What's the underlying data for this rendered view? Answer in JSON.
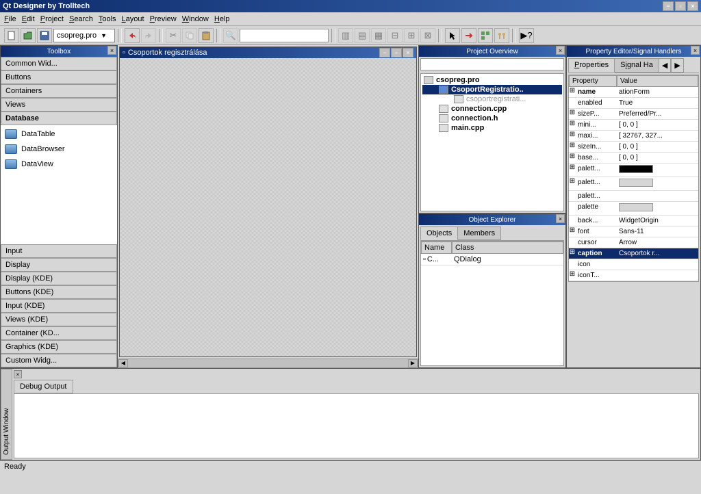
{
  "window": {
    "title": "Qt Designer by Trolltech"
  },
  "menus": {
    "file": "File",
    "edit": "Edit",
    "project": "Project",
    "search": "Search",
    "tools": "Tools",
    "layout": "Layout",
    "preview": "Preview",
    "window": "Window",
    "help": "Help"
  },
  "toolbar": {
    "project": "csopreg.pro"
  },
  "toolbox": {
    "title": "Toolbox",
    "sections": {
      "common": "Common Wid...",
      "buttons": "Buttons",
      "containers": "Containers",
      "views": "Views",
      "database": "Database",
      "input": "Input",
      "display": "Display",
      "displaykde": "Display (KDE)",
      "buttonskde": "Buttons (KDE)",
      "inputkde": "Input (KDE)",
      "viewskde": "Views (KDE)",
      "containerkde": "Container (KD...",
      "graphicskde": "Graphics (KDE)",
      "customwidg": "Custom Widg..."
    },
    "db_items": {
      "datatable": "DataTable",
      "databrowser": "DataBrowser",
      "dataview": "DataView"
    }
  },
  "design": {
    "title": "Csoportok regisztrálása"
  },
  "projectOverview": {
    "title": "Project Overview",
    "root": "csopreg.pro",
    "item_form": "CsoportRegistratio..",
    "item_ui": "csoportregistrati...",
    "item_conn_cpp": "connection.cpp",
    "item_conn_h": "connection.h",
    "item_main": "main.cpp"
  },
  "objectExplorer": {
    "title": "Object Explorer",
    "tab_objects": "Objects",
    "tab_members": "Members",
    "col_name": "Name",
    "col_class": "Class",
    "row_name": "C...",
    "row_class": "QDialog"
  },
  "propertyEditor": {
    "title": "Property Editor/Signal Handlers",
    "tab_prop": "Properties",
    "tab_sig": "Signal Ha",
    "col_prop": "Property",
    "col_val": "Value",
    "rows": {
      "name": {
        "k": "name",
        "v": "ationForm"
      },
      "enabled": {
        "k": "enabled",
        "v": "True"
      },
      "sizep": {
        "k": "sizeP...",
        "v": "Preferred/Pr..."
      },
      "mini": {
        "k": "mini...",
        "v": "[ 0, 0 ]"
      },
      "maxi": {
        "k": "maxi...",
        "v": "[ 32767, 327..."
      },
      "sizein": {
        "k": "sizeIn...",
        "v": "[ 0, 0 ]"
      },
      "base": {
        "k": "base...",
        "v": "[ 0, 0 ]"
      },
      "palett1": {
        "k": "palett..."
      },
      "palett2": {
        "k": "palett..."
      },
      "palett3": {
        "k": "palett..."
      },
      "palette": {
        "k": "palette"
      },
      "back": {
        "k": "back...",
        "v": "WidgetOrigin"
      },
      "font": {
        "k": "font",
        "v": "Sans-11"
      },
      "cursor": {
        "k": "cursor",
        "v": "Arrow"
      },
      "caption": {
        "k": "caption",
        "v": "Csoportok r..."
      },
      "icon": {
        "k": "icon"
      },
      "icont": {
        "k": "iconT..."
      }
    }
  },
  "debug": {
    "output_window": "Output Window",
    "tab": "Debug Output"
  },
  "status": {
    "text": "Ready"
  }
}
